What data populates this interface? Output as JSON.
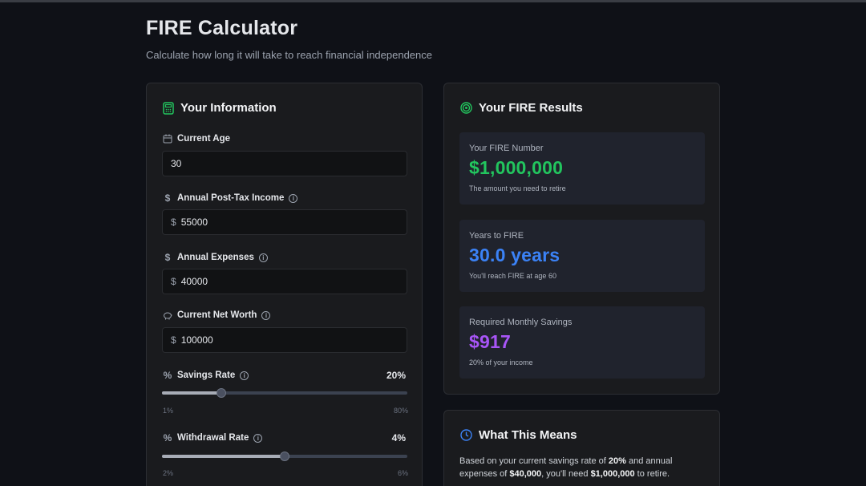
{
  "header": {
    "title": "FIRE Calculator",
    "subtitle": "Calculate how long it will take to reach financial independence"
  },
  "inputs_card": {
    "title": "Your Information",
    "icon": "calculator-icon",
    "fields": {
      "age": {
        "label": "Current Age",
        "value": "30"
      },
      "income": {
        "label": "Annual Post-Tax Income",
        "prefix": "$",
        "value": "55000"
      },
      "expenses": {
        "label": "Annual Expenses",
        "prefix": "$",
        "value": "40000"
      },
      "net_worth": {
        "label": "Current Net Worth",
        "prefix": "$",
        "value": "100000"
      }
    },
    "savings_rate": {
      "label": "Savings Rate",
      "display": "20%",
      "value": 20,
      "min": 1,
      "max": 80,
      "min_label": "1%",
      "max_label": "80%"
    },
    "withdrawal_rate": {
      "label": "Withdrawal Rate",
      "display": "4%",
      "value": 4,
      "min": 2,
      "max": 6,
      "min_label": "2%",
      "max_label": "6%"
    }
  },
  "results_card": {
    "title": "Your FIRE Results",
    "icon": "target-icon",
    "fire_number": {
      "label": "Your FIRE Number",
      "value": "$1,000,000",
      "note": "The amount you need to retire",
      "color": "#22c55e"
    },
    "years": {
      "label": "Years to FIRE",
      "value": "30.0 years",
      "note": "You'll reach FIRE at age 60",
      "color": "#3b82f6"
    },
    "monthly": {
      "label": "Required Monthly Savings",
      "value": "$917",
      "note": "20% of your income",
      "color": "#a855f7"
    }
  },
  "means_card": {
    "title": "What This Means",
    "icon": "clock-icon",
    "text_1": "Based on your current savings rate of ",
    "rate": "20%",
    "text_2": " and annual expenses of ",
    "expenses": "$40,000",
    "text_3": ", you'll need ",
    "fire_number": "$1,000,000",
    "text_4": " to retire."
  },
  "colors": {
    "accent_green": "#22c55e",
    "accent_blue": "#3b82f6",
    "accent_purple": "#a855f7"
  }
}
